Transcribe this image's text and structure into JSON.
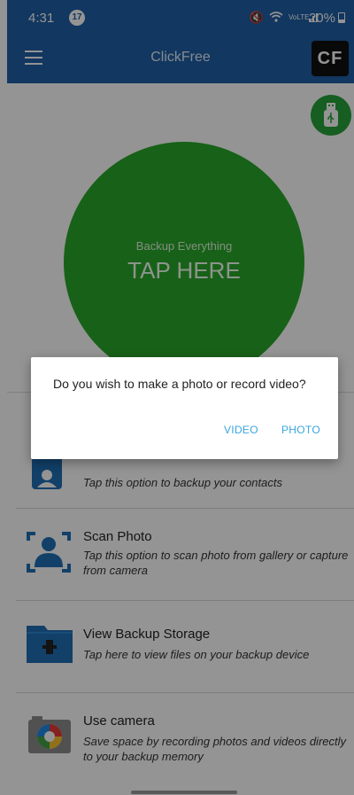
{
  "status_bar": {
    "time": "4:31",
    "notification_count": "17",
    "signal_text": "VoLTE",
    "battery": "20%"
  },
  "app_bar": {
    "title": "ClickFree",
    "logo_text": "CF"
  },
  "main": {
    "circle_subtitle": "Backup Everything",
    "circle_title": "TAP HERE"
  },
  "options": [
    {
      "icon": "contacts-icon",
      "title": "",
      "description": "Tap this option to backup your contacts"
    },
    {
      "icon": "scan-photo-icon",
      "title": "Scan Photo",
      "description": "Tap this option to scan photo from gallery or capture from camera"
    },
    {
      "icon": "folder-usb-icon",
      "title": "View Backup Storage",
      "description": "Tap here to view files on your backup device"
    },
    {
      "icon": "camera-icon",
      "title": "Use camera",
      "description": "Save space by recording photos and videos directly to your backup memory"
    }
  ],
  "dialog": {
    "message": "Do you wish to make a photo or record video?",
    "video_label": "VIDEO",
    "photo_label": "PHOTO"
  },
  "colors": {
    "app_bar": "#1f5fa6",
    "circle": "#2aa82a",
    "dialog_button": "#3ba6e0"
  }
}
